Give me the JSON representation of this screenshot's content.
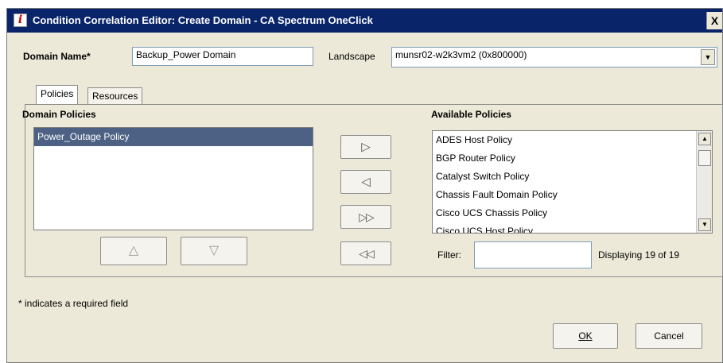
{
  "window": {
    "title": "Condition Correlation Editor: Create Domain - CA Spectrum OneClick",
    "icon_glyph": "i",
    "close_glyph": "X"
  },
  "form": {
    "domain_name_label": "Domain Name*",
    "domain_name_value": "Backup_Power Domain",
    "landscape_label": "Landscape",
    "landscape_value": "munsr02-w2k3vm2 (0x800000)",
    "combo_arrow_glyph": "▼"
  },
  "tabs": [
    {
      "label": "Policies",
      "active": true
    },
    {
      "label": "Resources",
      "active": false
    }
  ],
  "domain_policies": {
    "title": "Domain Policies",
    "items": [
      {
        "label": "Power_Outage Policy",
        "selected": true
      }
    ],
    "move_up_glyph": "△",
    "move_down_glyph": "▽"
  },
  "transfer_buttons": {
    "add_one": "▷",
    "remove_one": "◁",
    "add_all": "▷▷",
    "remove_all": "◁◁"
  },
  "available_policies": {
    "title": "Available Policies",
    "items": [
      "ADES Host Policy",
      "BGP Router Policy",
      "Catalyst Switch Policy",
      "Chassis Fault Domain Policy",
      "Cisco UCS Chassis Policy",
      "Cisco UCS Host Policy"
    ],
    "scroll_up_glyph": "▲",
    "scroll_down_glyph": "▼",
    "filter_label": "Filter:",
    "filter_value": "",
    "displaying": "Displaying 19 of 19"
  },
  "footer": {
    "required_note": "* indicates a required field",
    "ok_label": "OK",
    "cancel_label": "Cancel"
  }
}
